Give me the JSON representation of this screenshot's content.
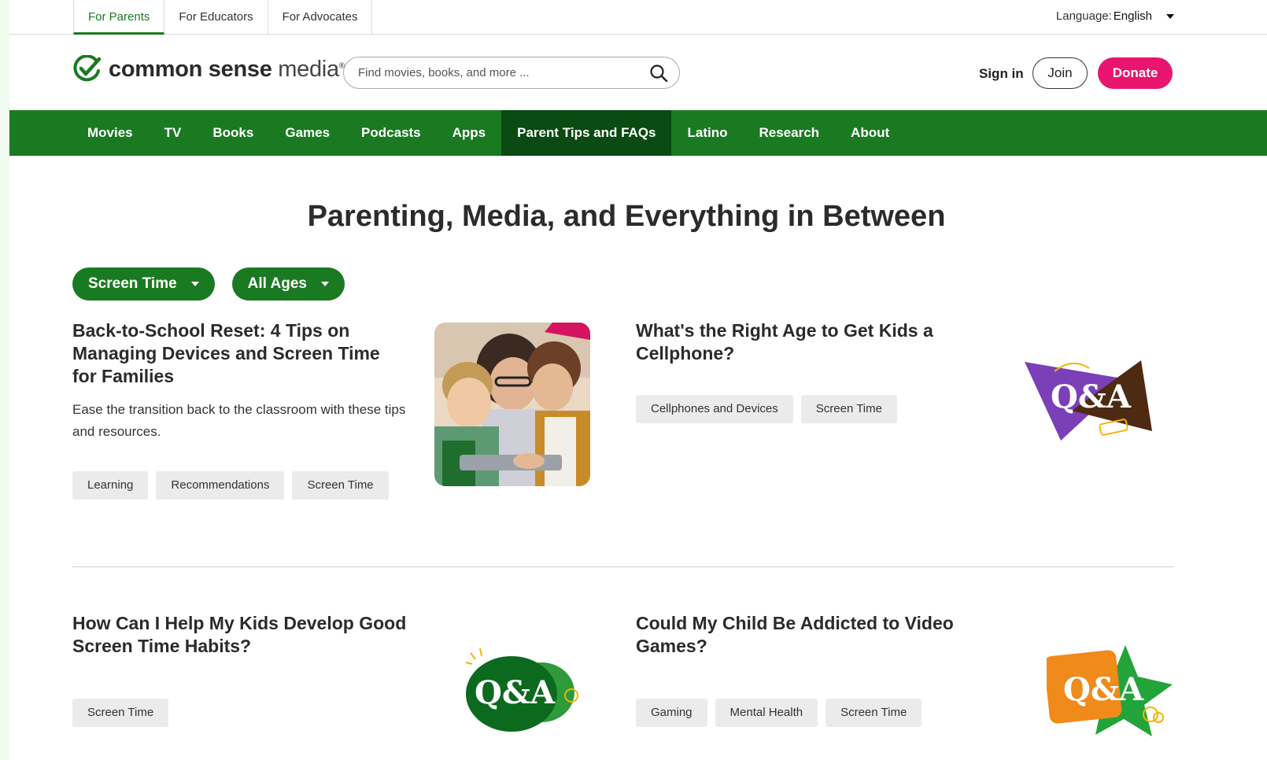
{
  "audience_tabs": [
    "For Parents",
    "For Educators",
    "For Advocates"
  ],
  "language": {
    "label": "Language:",
    "value": "English"
  },
  "logo": {
    "bold": "common sense",
    "light": "media",
    "mark": "®"
  },
  "search": {
    "placeholder": "Find movies, books, and more ..."
  },
  "header": {
    "signin": "Sign in",
    "join": "Join",
    "donate": "Donate"
  },
  "nav": [
    "Movies",
    "TV",
    "Books",
    "Games",
    "Podcasts",
    "Apps",
    "Parent Tips and FAQs",
    "Latino",
    "Research",
    "About"
  ],
  "page_title": "Parenting, Media, and Everything in Between",
  "filters": [
    "Screen Time",
    "All Ages"
  ],
  "articles": [
    {
      "title": "Back-to-School Reset: 4 Tips on Managing Devices and Screen Time for Families",
      "summary": "Ease the transition back to the classroom with these tips and resources.",
      "tags": [
        "Learning",
        "Recommendations",
        "Screen Time"
      ]
    },
    {
      "title": "What's the Right Age to Get Kids a Cellphone?",
      "tags": [
        "Cellphones and Devices",
        "Screen Time"
      ],
      "thumb_text": "Q&A"
    },
    {
      "title": "How Can I Help My Kids Develop Good Screen Time Habits?",
      "tags": [
        "Screen Time"
      ],
      "thumb_text": "Q&A"
    },
    {
      "title": "Could My Child Be Addicted to Video Games?",
      "tags": [
        "Gaming",
        "Mental Health",
        "Screen Time"
      ],
      "thumb_text": "Q&A"
    }
  ],
  "colors": {
    "brand_green": "#1a7a22",
    "nav_active": "#0b4a12",
    "donate_pink": "#e8156e"
  }
}
